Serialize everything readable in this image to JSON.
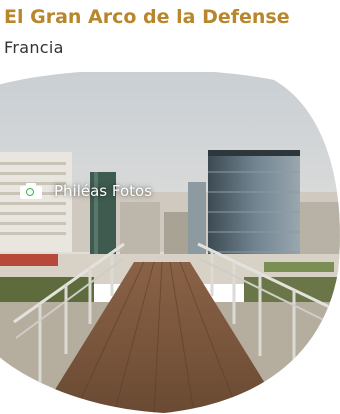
{
  "place": {
    "title": "El Gran Arco de la Defense",
    "country": "Francia"
  },
  "photo": {
    "credit": "Philéas Fotos",
    "credit_icon": "camera-icon"
  },
  "colors": {
    "title": "#b8862b",
    "icon_lens": "#3fb24a"
  }
}
